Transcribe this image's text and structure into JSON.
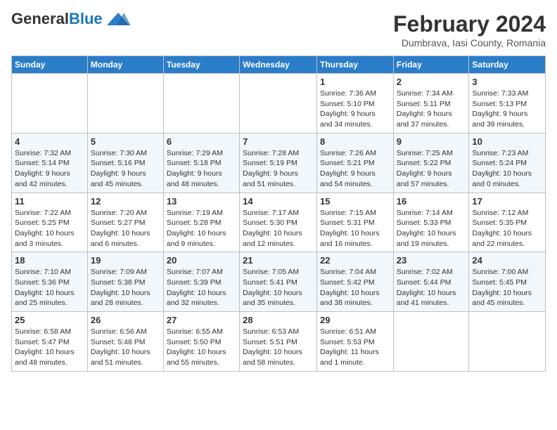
{
  "header": {
    "logo_general": "General",
    "logo_blue": "Blue",
    "title": "February 2024",
    "subtitle": "Dumbrava, Iasi County, Romania"
  },
  "weekdays": [
    "Sunday",
    "Monday",
    "Tuesday",
    "Wednesday",
    "Thursday",
    "Friday",
    "Saturday"
  ],
  "weeks": [
    [
      {
        "day": "",
        "info": ""
      },
      {
        "day": "",
        "info": ""
      },
      {
        "day": "",
        "info": ""
      },
      {
        "day": "",
        "info": ""
      },
      {
        "day": "1",
        "info": "Sunrise: 7:36 AM\nSunset: 5:10 PM\nDaylight: 9 hours\nand 34 minutes."
      },
      {
        "day": "2",
        "info": "Sunrise: 7:34 AM\nSunset: 5:11 PM\nDaylight: 9 hours\nand 37 minutes."
      },
      {
        "day": "3",
        "info": "Sunrise: 7:33 AM\nSunset: 5:13 PM\nDaylight: 9 hours\nand 39 minutes."
      }
    ],
    [
      {
        "day": "4",
        "info": "Sunrise: 7:32 AM\nSunset: 5:14 PM\nDaylight: 9 hours\nand 42 minutes."
      },
      {
        "day": "5",
        "info": "Sunrise: 7:30 AM\nSunset: 5:16 PM\nDaylight: 9 hours\nand 45 minutes."
      },
      {
        "day": "6",
        "info": "Sunrise: 7:29 AM\nSunset: 5:18 PM\nDaylight: 9 hours\nand 48 minutes."
      },
      {
        "day": "7",
        "info": "Sunrise: 7:28 AM\nSunset: 5:19 PM\nDaylight: 9 hours\nand 51 minutes."
      },
      {
        "day": "8",
        "info": "Sunrise: 7:26 AM\nSunset: 5:21 PM\nDaylight: 9 hours\nand 54 minutes."
      },
      {
        "day": "9",
        "info": "Sunrise: 7:25 AM\nSunset: 5:22 PM\nDaylight: 9 hours\nand 57 minutes."
      },
      {
        "day": "10",
        "info": "Sunrise: 7:23 AM\nSunset: 5:24 PM\nDaylight: 10 hours\nand 0 minutes."
      }
    ],
    [
      {
        "day": "11",
        "info": "Sunrise: 7:22 AM\nSunset: 5:25 PM\nDaylight: 10 hours\nand 3 minutes."
      },
      {
        "day": "12",
        "info": "Sunrise: 7:20 AM\nSunset: 5:27 PM\nDaylight: 10 hours\nand 6 minutes."
      },
      {
        "day": "13",
        "info": "Sunrise: 7:19 AM\nSunset: 5:28 PM\nDaylight: 10 hours\nand 9 minutes."
      },
      {
        "day": "14",
        "info": "Sunrise: 7:17 AM\nSunset: 5:30 PM\nDaylight: 10 hours\nand 12 minutes."
      },
      {
        "day": "15",
        "info": "Sunrise: 7:15 AM\nSunset: 5:31 PM\nDaylight: 10 hours\nand 16 minutes."
      },
      {
        "day": "16",
        "info": "Sunrise: 7:14 AM\nSunset: 5:33 PM\nDaylight: 10 hours\nand 19 minutes."
      },
      {
        "day": "17",
        "info": "Sunrise: 7:12 AM\nSunset: 5:35 PM\nDaylight: 10 hours\nand 22 minutes."
      }
    ],
    [
      {
        "day": "18",
        "info": "Sunrise: 7:10 AM\nSunset: 5:36 PM\nDaylight: 10 hours\nand 25 minutes."
      },
      {
        "day": "19",
        "info": "Sunrise: 7:09 AM\nSunset: 5:38 PM\nDaylight: 10 hours\nand 28 minutes."
      },
      {
        "day": "20",
        "info": "Sunrise: 7:07 AM\nSunset: 5:39 PM\nDaylight: 10 hours\nand 32 minutes."
      },
      {
        "day": "21",
        "info": "Sunrise: 7:05 AM\nSunset: 5:41 PM\nDaylight: 10 hours\nand 35 minutes."
      },
      {
        "day": "22",
        "info": "Sunrise: 7:04 AM\nSunset: 5:42 PM\nDaylight: 10 hours\nand 38 minutes."
      },
      {
        "day": "23",
        "info": "Sunrise: 7:02 AM\nSunset: 5:44 PM\nDaylight: 10 hours\nand 41 minutes."
      },
      {
        "day": "24",
        "info": "Sunrise: 7:00 AM\nSunset: 5:45 PM\nDaylight: 10 hours\nand 45 minutes."
      }
    ],
    [
      {
        "day": "25",
        "info": "Sunrise: 6:58 AM\nSunset: 5:47 PM\nDaylight: 10 hours\nand 48 minutes."
      },
      {
        "day": "26",
        "info": "Sunrise: 6:56 AM\nSunset: 5:48 PM\nDaylight: 10 hours\nand 51 minutes."
      },
      {
        "day": "27",
        "info": "Sunrise: 6:55 AM\nSunset: 5:50 PM\nDaylight: 10 hours\nand 55 minutes."
      },
      {
        "day": "28",
        "info": "Sunrise: 6:53 AM\nSunset: 5:51 PM\nDaylight: 10 hours\nand 58 minutes."
      },
      {
        "day": "29",
        "info": "Sunrise: 6:51 AM\nSunset: 5:53 PM\nDaylight: 11 hours\nand 1 minute."
      },
      {
        "day": "",
        "info": ""
      },
      {
        "day": "",
        "info": ""
      }
    ]
  ]
}
